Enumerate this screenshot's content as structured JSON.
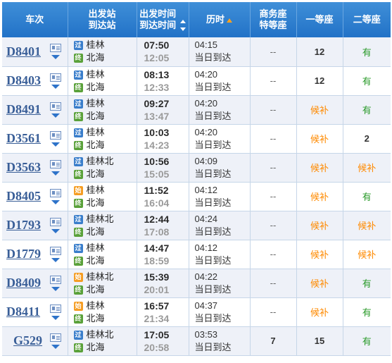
{
  "header": {
    "train": "车次",
    "from_station": "出发站",
    "to_station": "到达站",
    "dep_time": "出发时间",
    "arr_time": "到达时间",
    "duration": "历时",
    "business_seat_1": "商务座",
    "business_seat_2": "特等座",
    "first_class": "一等座",
    "second_class": "二等座"
  },
  "badges": {
    "pass": "过",
    "start": "始",
    "end": "终"
  },
  "rows": [
    {
      "train": "D8401",
      "from": "桂林",
      "from_type": "pass",
      "to": "北海",
      "to_type": "end",
      "dep": "07:50",
      "arr": "12:05",
      "duration": "04:15",
      "arrive_day": "当日到达",
      "business": "--",
      "first": "12",
      "second": "有"
    },
    {
      "train": "D8403",
      "from": "桂林",
      "from_type": "pass",
      "to": "北海",
      "to_type": "end",
      "dep": "08:13",
      "arr": "12:33",
      "duration": "04:20",
      "arrive_day": "当日到达",
      "business": "--",
      "first": "12",
      "second": "有"
    },
    {
      "train": "D8491",
      "from": "桂林",
      "from_type": "pass",
      "to": "北海",
      "to_type": "end",
      "dep": "09:27",
      "arr": "13:47",
      "duration": "04:20",
      "arrive_day": "当日到达",
      "business": "--",
      "first": "候补",
      "second": "有"
    },
    {
      "train": "D3561",
      "from": "桂林",
      "from_type": "pass",
      "to": "北海",
      "to_type": "end",
      "dep": "10:03",
      "arr": "14:23",
      "duration": "04:20",
      "arrive_day": "当日到达",
      "business": "--",
      "first": "候补",
      "second": "2"
    },
    {
      "train": "D3563",
      "from": "桂林北",
      "from_type": "pass",
      "to": "北海",
      "to_type": "end",
      "dep": "10:56",
      "arr": "15:05",
      "duration": "04:09",
      "arrive_day": "当日到达",
      "business": "--",
      "first": "候补",
      "second": "候补"
    },
    {
      "train": "D8405",
      "from": "桂林",
      "from_type": "start",
      "to": "北海",
      "to_type": "end",
      "dep": "11:52",
      "arr": "16:04",
      "duration": "04:12",
      "arrive_day": "当日到达",
      "business": "--",
      "first": "候补",
      "second": "有"
    },
    {
      "train": "D1793",
      "from": "桂林北",
      "from_type": "pass",
      "to": "北海",
      "to_type": "end",
      "dep": "12:44",
      "arr": "17:08",
      "duration": "04:24",
      "arrive_day": "当日到达",
      "business": "--",
      "first": "候补",
      "second": "候补"
    },
    {
      "train": "D1779",
      "from": "桂林",
      "from_type": "pass",
      "to": "北海",
      "to_type": "end",
      "dep": "14:47",
      "arr": "18:59",
      "duration": "04:12",
      "arrive_day": "当日到达",
      "business": "--",
      "first": "候补",
      "second": "候补"
    },
    {
      "train": "D8409",
      "from": "桂林北",
      "from_type": "start",
      "to": "北海",
      "to_type": "end",
      "dep": "15:39",
      "arr": "20:01",
      "duration": "04:22",
      "arrive_day": "当日到达",
      "business": "--",
      "first": "候补",
      "second": "有"
    },
    {
      "train": "D8411",
      "from": "桂林",
      "from_type": "start",
      "to": "北海",
      "to_type": "end",
      "dep": "16:57",
      "arr": "21:34",
      "duration": "04:37",
      "arrive_day": "当日到达",
      "business": "--",
      "first": "候补",
      "second": "有"
    },
    {
      "train": "G529",
      "from": "桂林北",
      "from_type": "pass",
      "to": "北海",
      "to_type": "end",
      "dep": "17:05",
      "arr": "20:58",
      "duration": "03:53",
      "arrive_day": "当日到达",
      "business": "7",
      "first": "15",
      "second": "有"
    }
  ],
  "colors": {
    "header_bg": "#2272c7",
    "train_link": "#3a5f98",
    "available": "#2a9a2a",
    "waitlist": "#ff8a00",
    "row_alt": "#eef1f8"
  }
}
